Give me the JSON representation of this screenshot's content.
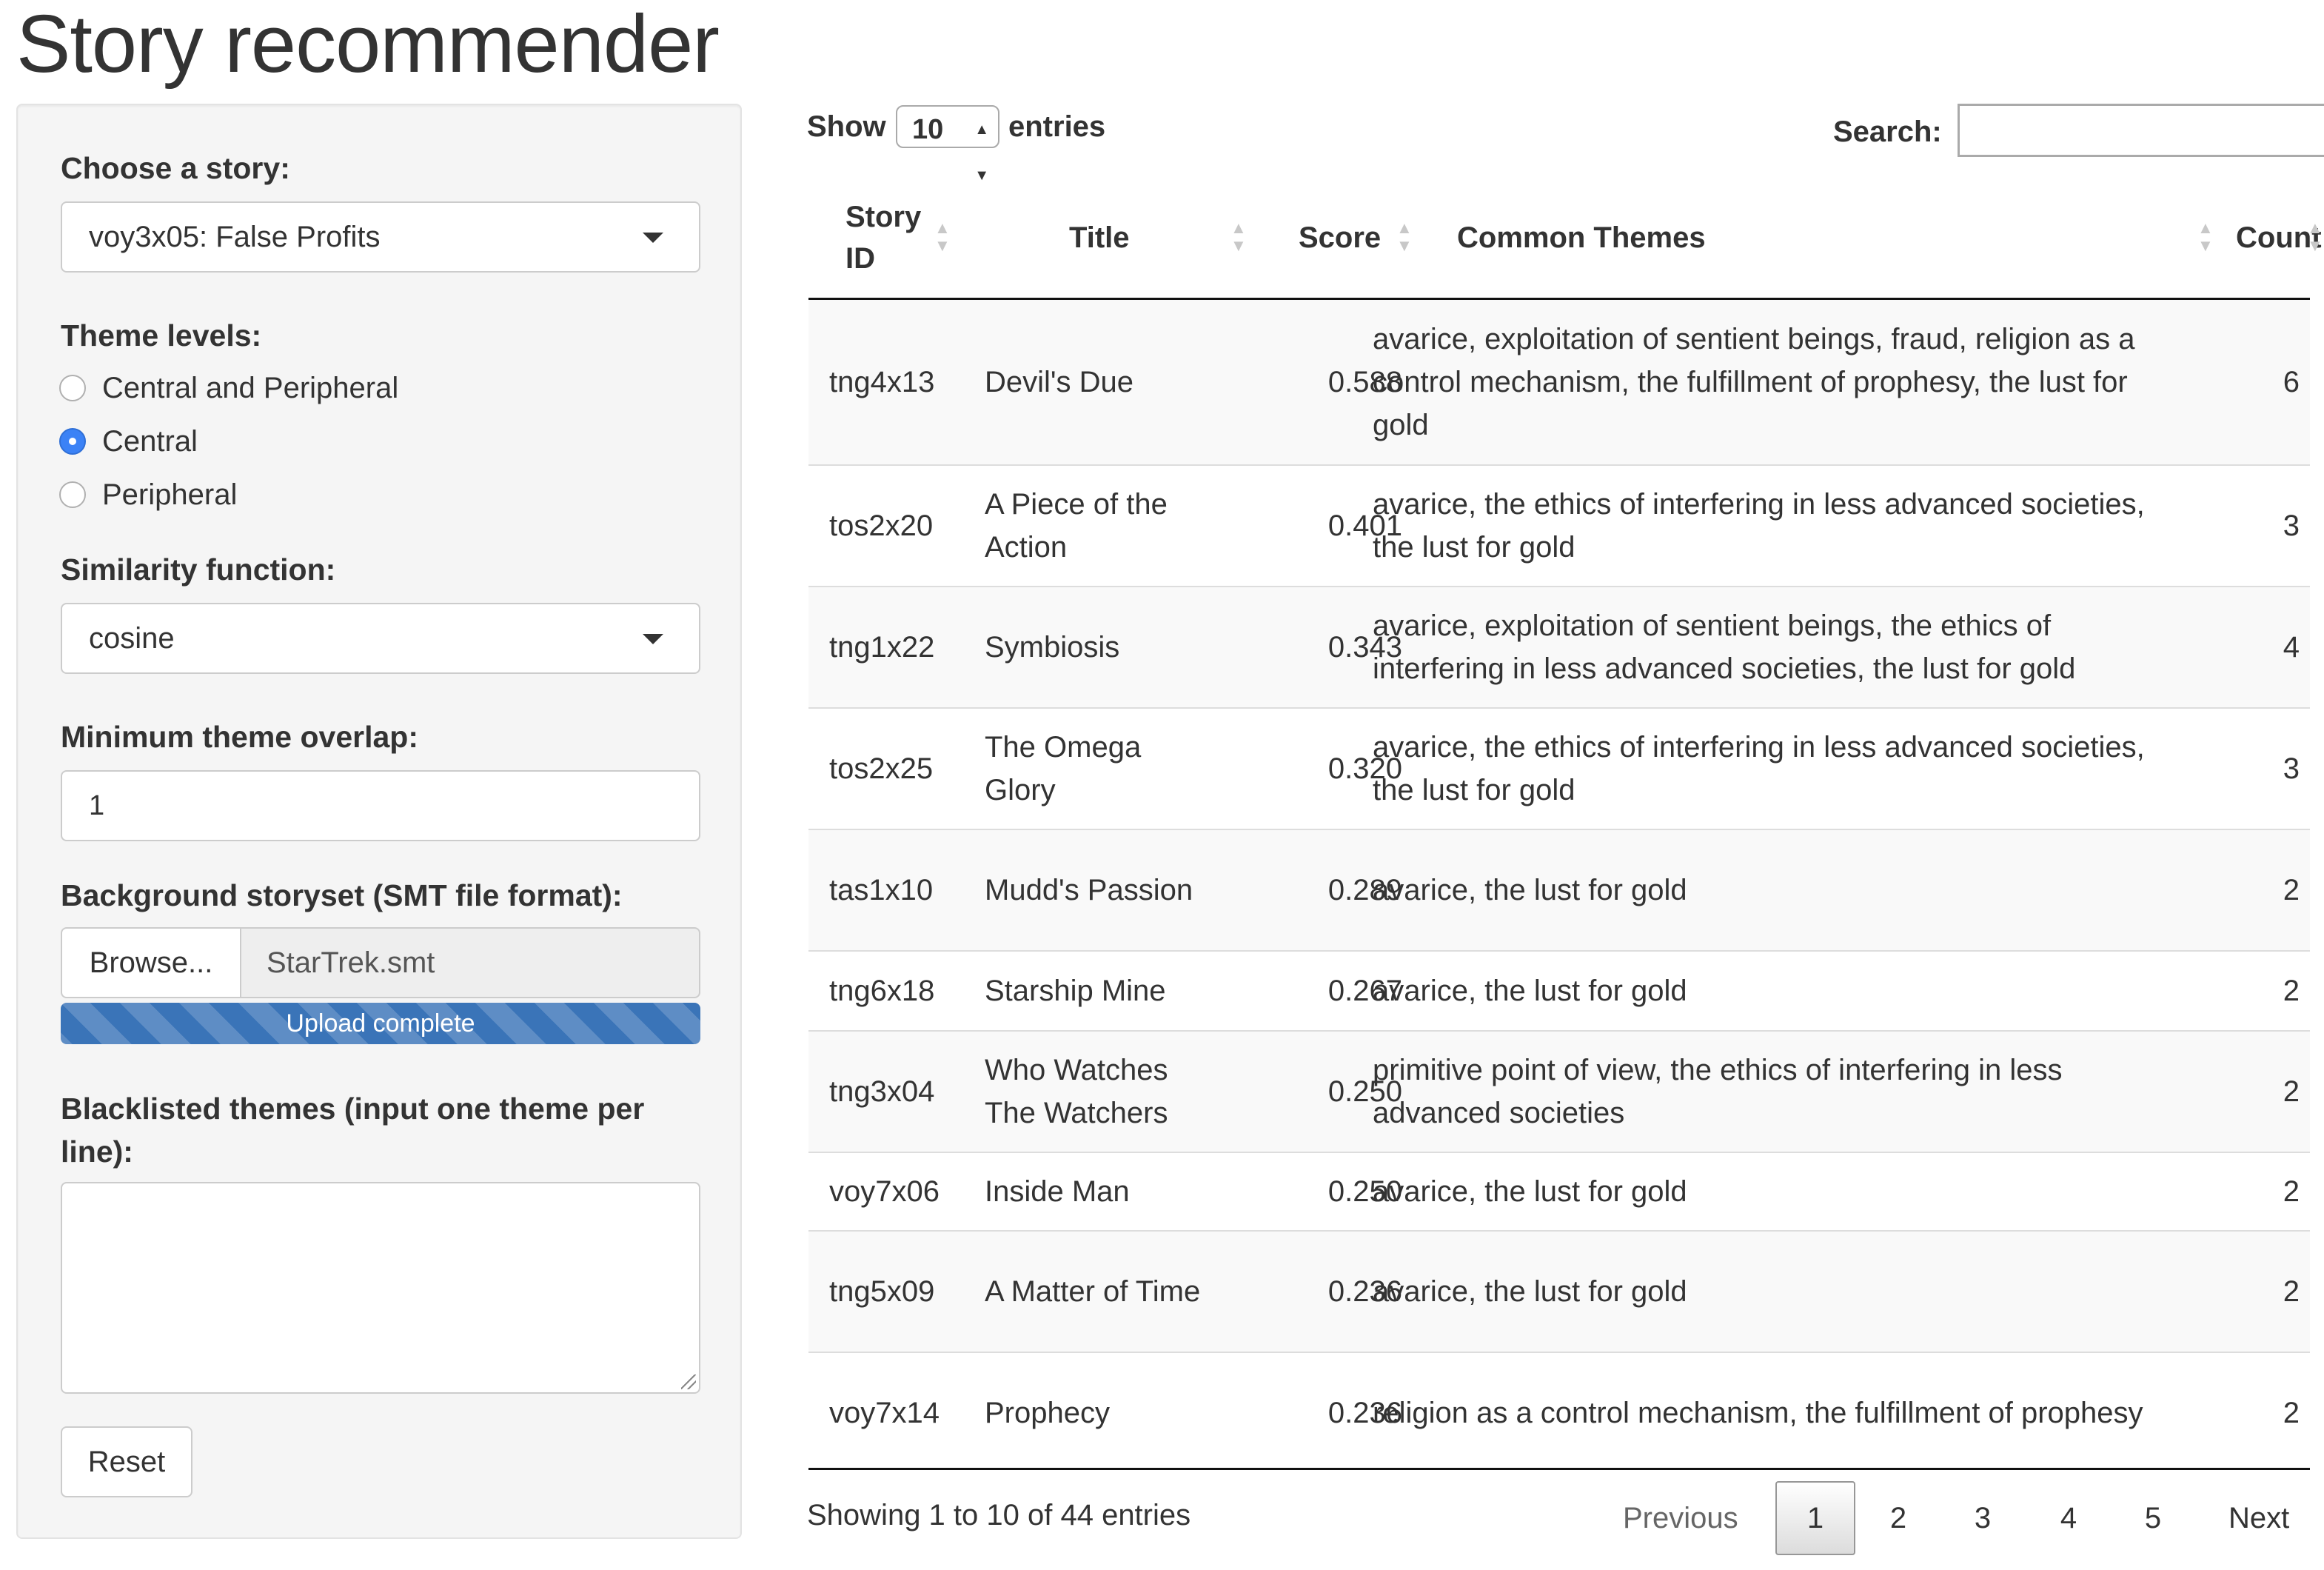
{
  "app": {
    "title": "Story recommender"
  },
  "sidebar": {
    "story_label": "Choose a story:",
    "story_value": "voy3x05: False Profits",
    "theme_levels_label": "Theme levels:",
    "theme_levels": [
      {
        "label": "Central and Peripheral",
        "selected": false
      },
      {
        "label": "Central",
        "selected": true
      },
      {
        "label": "Peripheral",
        "selected": false
      }
    ],
    "similarity_label": "Similarity function:",
    "similarity_value": "cosine",
    "overlap_label": "Minimum theme overlap:",
    "overlap_value": "1",
    "background_label": "Background storyset (SMT file format):",
    "browse_label": "Browse...",
    "file_name": "StarTrek.smt",
    "upload_status": "Upload complete",
    "upload_progress": 1.0,
    "blacklist_label_1": "Blacklisted themes (input one theme per",
    "blacklist_label_2": "line):",
    "blacklist_value": "",
    "reset_label": "Reset"
  },
  "table_controls": {
    "show_label": "Show",
    "entries_per_page": "10",
    "entries_label": "entries",
    "search_label": "Search:",
    "search_value": ""
  },
  "table": {
    "headers": {
      "story_id_1": "Story",
      "story_id_2": "ID",
      "title": "Title",
      "score": "Score",
      "common_themes": "Common Themes",
      "count": "Count"
    },
    "rows": [
      {
        "id": "tng4x13",
        "title": "Devil's Due",
        "score": "0.588",
        "themes": "avarice, exploitation of sentient beings, fraud, religion as a control mechanism, the fulfillment of prophesy, the lust for gold",
        "count": "6"
      },
      {
        "id": "tos2x20",
        "title": "A Piece of the Action",
        "score": "0.401",
        "themes": "avarice, the ethics of interfering in less advanced societies, the lust for gold",
        "count": "3"
      },
      {
        "id": "tng1x22",
        "title": "Symbiosis",
        "score": "0.343",
        "themes": "avarice, exploitation of sentient beings, the ethics of interfering in less advanced societies, the lust for gold",
        "count": "4"
      },
      {
        "id": "tos2x25",
        "title": "The Omega Glory",
        "score": "0.320",
        "themes": "avarice, the ethics of interfering in less advanced societies, the lust for gold",
        "count": "3"
      },
      {
        "id": "tas1x10",
        "title": "Mudd's Passion",
        "score": "0.289",
        "themes": "avarice, the lust for gold",
        "count": "2"
      },
      {
        "id": "tng6x18",
        "title": "Starship Mine",
        "score": "0.267",
        "themes": "avarice, the lust for gold",
        "count": "2"
      },
      {
        "id": "tng3x04",
        "title": "Who Watches The Watchers",
        "score": "0.250",
        "themes": "primitive point of view, the ethics of interfering in less advanced societies",
        "count": "2"
      },
      {
        "id": "voy7x06",
        "title": "Inside Man",
        "score": "0.250",
        "themes": "avarice, the lust for gold",
        "count": "2"
      },
      {
        "id": "tng5x09",
        "title": "A Matter of Time",
        "score": "0.236",
        "themes": "avarice, the lust for gold",
        "count": "2"
      },
      {
        "id": "voy7x14",
        "title": "Prophecy",
        "score": "0.236",
        "themes": "religion as a control mechanism, the fulfillment of prophesy",
        "count": "2"
      }
    ]
  },
  "footer": {
    "info": "Showing 1 to 10 of 44 entries",
    "previous": "Previous",
    "pages": [
      "1",
      "2",
      "3",
      "4",
      "5"
    ],
    "active_page": "1",
    "next": "Next"
  },
  "colors": {
    "accent": "#3b82f6",
    "progress": "#3a74b8"
  }
}
